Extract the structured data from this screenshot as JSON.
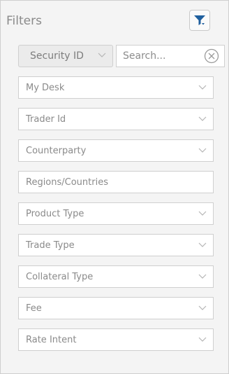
{
  "header": {
    "title": "Filters",
    "filter_button_icon": "filter-icon"
  },
  "security": {
    "selected": "Security ID",
    "search_placeholder": "Search...",
    "search_value": ""
  },
  "filters": [
    {
      "label": "My Desk",
      "dropdown": true
    },
    {
      "label": "Trader Id",
      "dropdown": true
    },
    {
      "label": "Counterparty",
      "dropdown": true
    },
    {
      "label": "Regions/Countries",
      "dropdown": false
    },
    {
      "label": "Product Type",
      "dropdown": true
    },
    {
      "label": "Trade Type",
      "dropdown": true
    },
    {
      "label": "Collateral Type",
      "dropdown": true
    },
    {
      "label": "Fee",
      "dropdown": true
    },
    {
      "label": "Rate Intent",
      "dropdown": true
    }
  ],
  "colors": {
    "accent": "#1f5f9e",
    "border": "#cfcfcf",
    "background": "#f4f4f4"
  }
}
